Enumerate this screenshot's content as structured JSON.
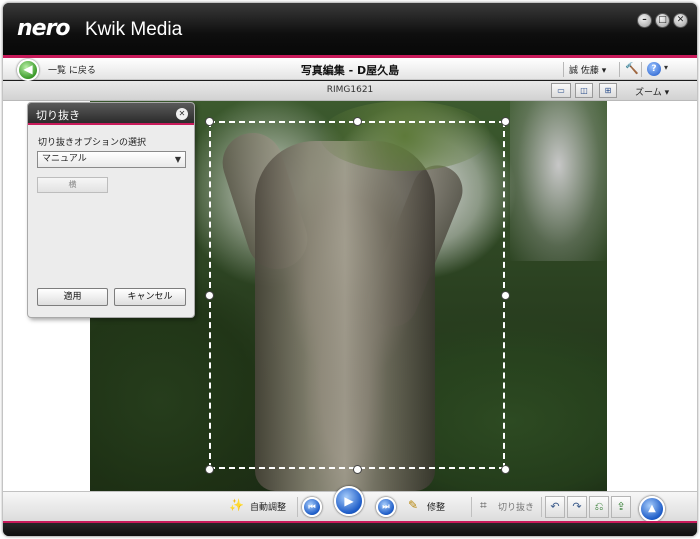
{
  "app": {
    "brand": "nero",
    "name": "Kwik Media"
  },
  "window_controls": {
    "minimize": "–",
    "maximize": "□",
    "close": "✕"
  },
  "nav": {
    "back_label": "一覧 に戻る",
    "title": "写真編集 - D屋久島",
    "user_label": "誠 佐藤",
    "user_caret": "▾",
    "help_label": "?",
    "help_caret": "▾"
  },
  "subbar": {
    "file_name": "RIMG1621",
    "zoom_label": "ズーム ▾"
  },
  "crop_panel": {
    "title": "切り抜き",
    "option_label": "切り抜きオプションの選択",
    "option_value": "マニュアル",
    "orientation_label": "横",
    "apply_label": "適用",
    "cancel_label": "キャンセル"
  },
  "toolbar": {
    "auto_adjust_label": "自動調整",
    "retouch_label": "修整",
    "crop_label": "切り抜き"
  },
  "colors": {
    "accent": "#c81a5a",
    "play_blue": "#1c5bc7"
  }
}
